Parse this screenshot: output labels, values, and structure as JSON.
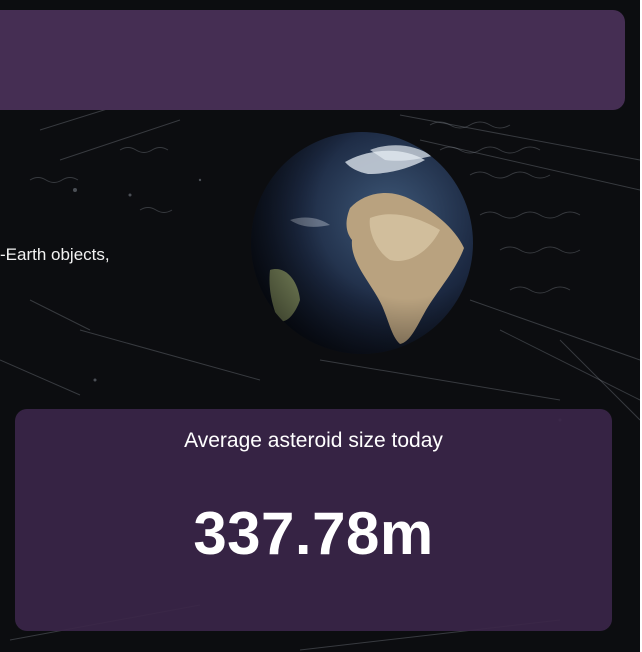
{
  "intro": {
    "text": "-Earth objects,"
  },
  "stat_card": {
    "title": "Average asteroid size today",
    "value": "337.78m"
  },
  "colors": {
    "panel": "#452e53",
    "card": "#3a2648",
    "background": "#0c0d10"
  }
}
